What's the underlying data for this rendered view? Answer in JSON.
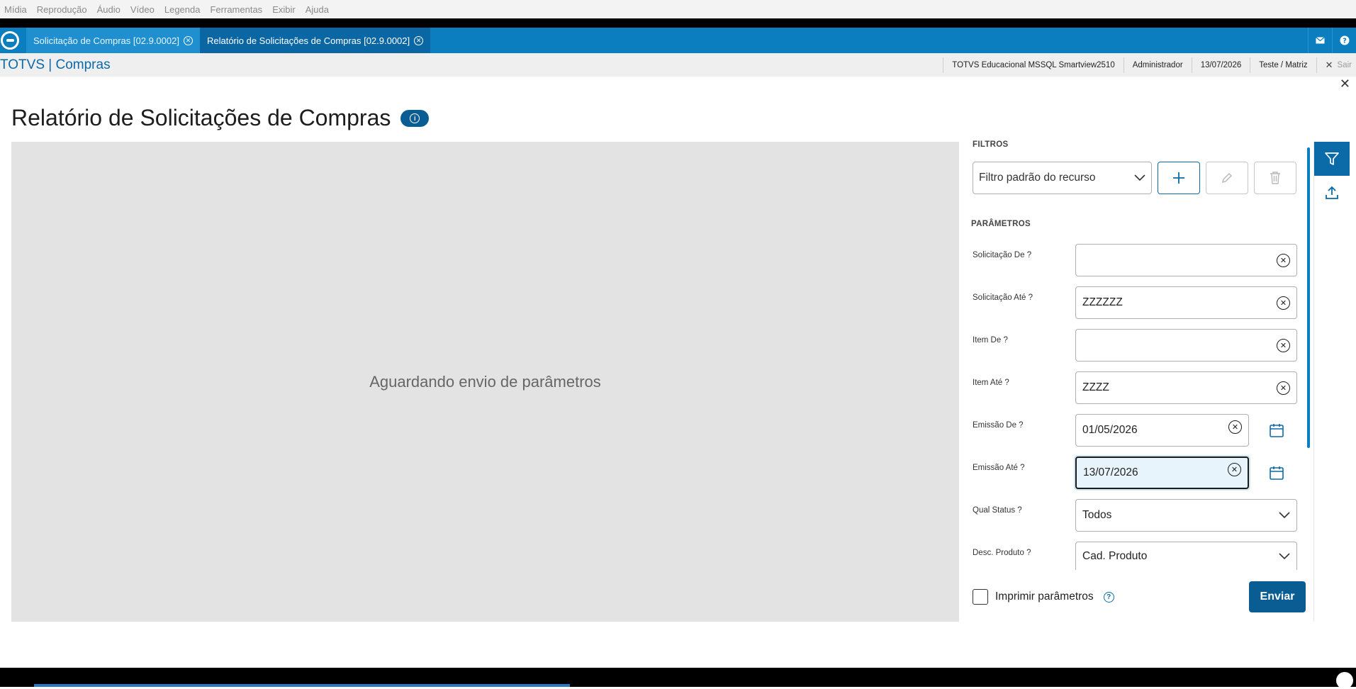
{
  "menubar": {
    "items": [
      "Mídia",
      "Reprodução",
      "Áudio",
      "Vídeo",
      "Legenda",
      "Ferramentas",
      "Exibir",
      "Ajuda"
    ]
  },
  "tabs": [
    {
      "label": "Solicitação de Compras [02.9.0002]",
      "active": false
    },
    {
      "label": "Relatório de Solicitações de Compras [02.9.0002]",
      "active": true
    }
  ],
  "appbar": {
    "title": "TOTVS | Compras",
    "environment": "TOTVS Educacional MSSQL Smartview2510",
    "user": "Administrador",
    "date": "13/07/2026",
    "branch": "Teste / Matriz",
    "logout": "Sair"
  },
  "page": {
    "title": "Relatório de Solicitações de Compras"
  },
  "preview": {
    "message": "Aguardando envio de parâmetros"
  },
  "filters": {
    "section": "FILTROS",
    "selected": "Filtro padrão do recurso"
  },
  "parameters": {
    "section": "PARÂMETROS",
    "fields": [
      {
        "label": "Solicitação De ?",
        "value": ""
      },
      {
        "label": "Solicitação Até ?",
        "value": "ZZZZZZ"
      },
      {
        "label": "Item De ?",
        "value": ""
      },
      {
        "label": "Item Até ?",
        "value": "ZZZZ"
      },
      {
        "label": "Emissão De ?",
        "value": "01/05/2026"
      },
      {
        "label": "Emissão Até ?",
        "value": "13/07/2026"
      },
      {
        "label": "Qual Status ?",
        "value": "Todos"
      },
      {
        "label": "Desc. Produto ?",
        "value": "Cad. Produto"
      }
    ]
  },
  "footer": {
    "print_params": "Imprimir parâmetros",
    "submit": "Enviar"
  },
  "colors": {
    "primary": "#0b6aa8",
    "tabbar": "#0b7ec0",
    "preview_bg": "#e3e3e3"
  }
}
